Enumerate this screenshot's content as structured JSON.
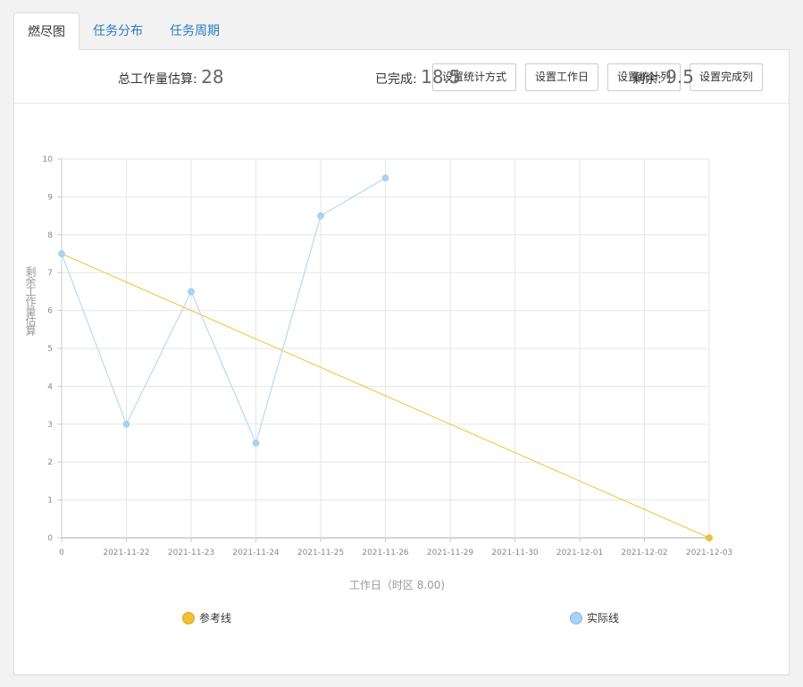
{
  "tabs": [
    {
      "label": "燃尽图",
      "active": true
    },
    {
      "label": "任务分布",
      "active": false
    },
    {
      "label": "任务周期",
      "active": false
    }
  ],
  "toolbar": {
    "buttons": [
      "设置统计方式",
      "设置工作日",
      "设置统计列",
      "设置完成列"
    ]
  },
  "stats": {
    "total_label": "总工作量估算:",
    "total_value": "28",
    "done_label": "已完成:",
    "done_value": "18.5",
    "remain_label": "剩余:",
    "remain_value": "9.5"
  },
  "chart_data": {
    "type": "line",
    "xlabel": "工作日（时区 8.00)",
    "ylabel": "剩余工作量估算",
    "categories": [
      "0",
      "2021-11-22",
      "2021-11-23",
      "2021-11-24",
      "2021-11-25",
      "2021-11-26",
      "2021-11-29",
      "2021-11-30",
      "2021-12-01",
      "2021-12-02",
      "2021-12-03"
    ],
    "ylim": [
      0,
      10
    ],
    "yticks": [
      0,
      1,
      2,
      3,
      4,
      5,
      6,
      7,
      8,
      9,
      10
    ],
    "grid": true,
    "legend_placement": "bottom",
    "series": [
      {
        "name": "参考线",
        "color": "#f0c231",
        "values": [
          7.5,
          null,
          null,
          null,
          null,
          null,
          null,
          null,
          null,
          null,
          0
        ],
        "marker_indices": [
          10
        ]
      },
      {
        "name": "实际线",
        "color": "#a9d4f5",
        "values": [
          7.5,
          3,
          6.5,
          2.5,
          8.5,
          9.5,
          null,
          null,
          null,
          null,
          null
        ],
        "marker_indices": [
          0,
          1,
          2,
          3,
          4,
          5
        ]
      }
    ]
  }
}
